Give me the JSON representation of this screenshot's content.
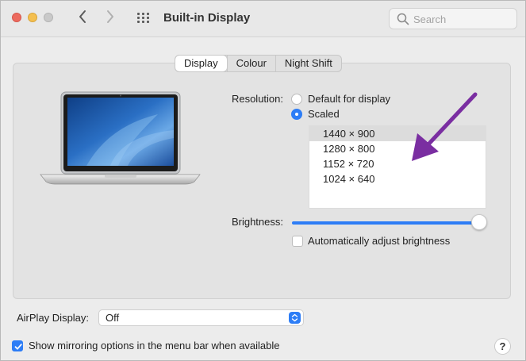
{
  "window": {
    "title": "Built-in Display",
    "search_placeholder": "Search"
  },
  "tabs": [
    {
      "label": "Display",
      "active": true
    },
    {
      "label": "Colour",
      "active": false
    },
    {
      "label": "Night Shift",
      "active": false
    }
  ],
  "resolution": {
    "label": "Resolution:",
    "options": [
      {
        "label": "Default for display",
        "selected": false
      },
      {
        "label": "Scaled",
        "selected": true
      }
    ],
    "scaled_list": [
      {
        "label": "1440 × 900",
        "selected": true
      },
      {
        "label": "1280 × 800",
        "selected": false
      },
      {
        "label": "1152 × 720",
        "selected": false
      },
      {
        "label": "1024 × 640",
        "selected": false
      }
    ]
  },
  "brightness": {
    "label": "Brightness:",
    "level_percent": 100,
    "auto_label": "Automatically adjust brightness",
    "auto_checked": false
  },
  "airplay": {
    "label": "AirPlay Display:",
    "value": "Off"
  },
  "mirroring": {
    "label": "Show mirroring options in the menu bar when available",
    "checked": true
  },
  "help_label": "?",
  "colors": {
    "accent": "#2d7df6",
    "annotation_arrow": "#7a2ea1"
  }
}
